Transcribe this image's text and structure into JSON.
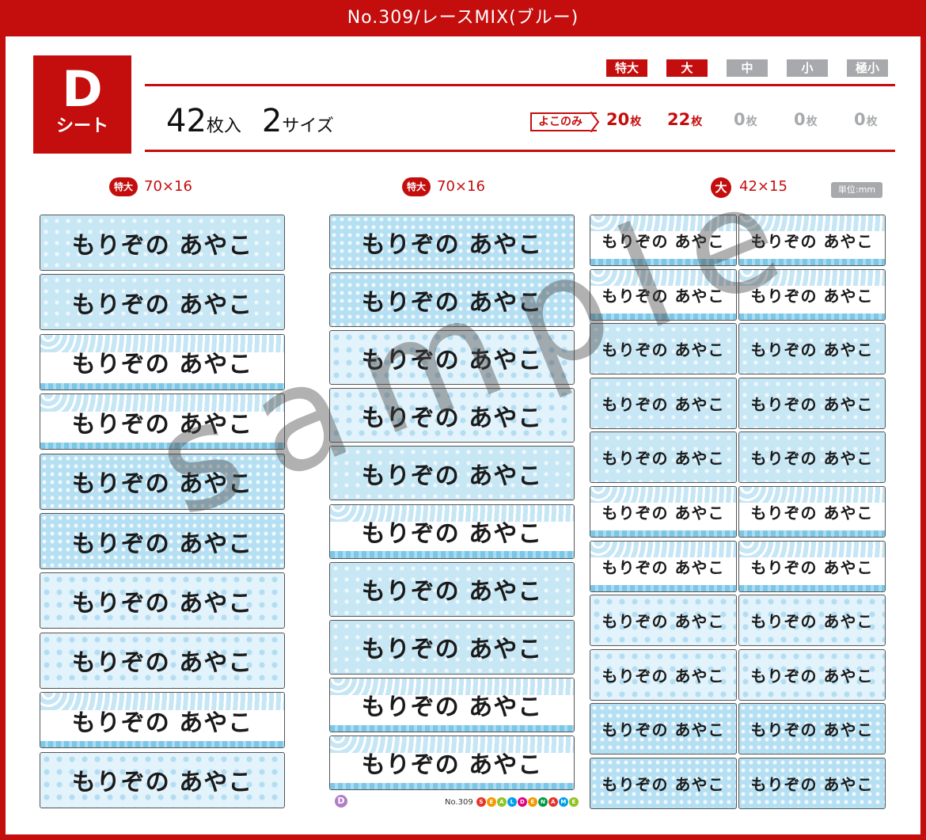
{
  "header": {
    "title": "No.309/レースMIX(ブルー)"
  },
  "sheet": {
    "letter": "D",
    "word": "シート"
  },
  "sizes": [
    {
      "label": "特大",
      "active": true
    },
    {
      "label": "大",
      "active": true
    },
    {
      "label": "中",
      "active": false
    },
    {
      "label": "小",
      "active": false
    },
    {
      "label": "極小",
      "active": false
    }
  ],
  "count": {
    "sheets": "42",
    "sheets_unit": "枚入",
    "sizes": "2",
    "sizes_unit": "サイズ"
  },
  "yoko_only": "よこのみ",
  "per_size_counts": [
    {
      "value": "20",
      "unit": "枚",
      "active": true
    },
    {
      "value": "22",
      "unit": "枚",
      "active": true
    },
    {
      "value": "0",
      "unit": "枚",
      "active": false
    },
    {
      "value": "0",
      "unit": "枚",
      "active": false
    },
    {
      "value": "0",
      "unit": "枚",
      "active": false
    }
  ],
  "columns": [
    {
      "badge": "特大",
      "dims": "70×16"
    },
    {
      "badge": "特大",
      "dims": "70×16"
    },
    {
      "badge": "大",
      "dims": "42×15"
    }
  ],
  "unit_note": "単位:mm",
  "label_text": "もりぞの あやこ",
  "watermark": "sample",
  "footer": {
    "sheet_letter": "D",
    "product_no": "No.309",
    "brand": "SEALDENAME"
  },
  "colors": {
    "brand_red": "#c40d0d",
    "inactive_gray": "#a7a9ac",
    "lace_blue": "#c8e7f6"
  }
}
